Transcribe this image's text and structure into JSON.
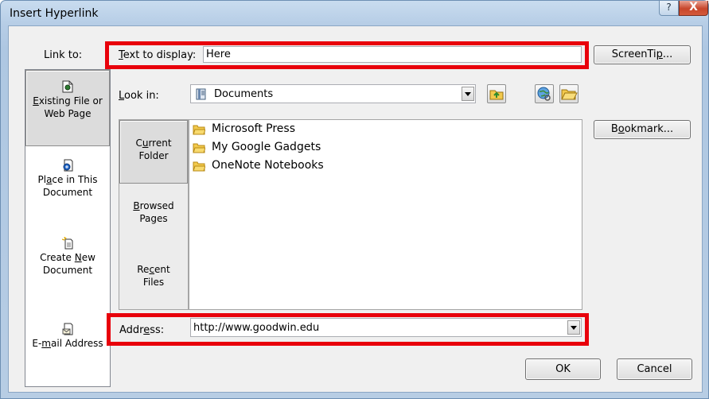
{
  "window": {
    "title": "Insert Hyperlink",
    "help_glyph": "?",
    "close_glyph": "X"
  },
  "link_to": {
    "label": "Link to:",
    "items": [
      {
        "pre": "",
        "ul": "E",
        "post": "xisting File or Web Page",
        "icon": "existing-file-icon"
      },
      {
        "pre": "Pl",
        "ul": "a",
        "post": "ce in This Document",
        "icon": "place-in-document-icon"
      },
      {
        "pre": "Create ",
        "ul": "N",
        "post": "ew Document",
        "icon": "new-document-icon"
      },
      {
        "pre": "E-",
        "ul": "m",
        "post": "ail Address",
        "icon": "email-icon"
      }
    ]
  },
  "text_to_display": {
    "label_ul": "T",
    "label_rest": "ext to display:",
    "value": "Here"
  },
  "screentip": {
    "pre": "ScreenTi",
    "ul": "p",
    "post": "..."
  },
  "look_in": {
    "label_ul": "L",
    "label_rest": "ook in:",
    "value": "Documents",
    "icon": "documents-folder-icon"
  },
  "toolbar": {
    "up_icon": "up-one-folder-icon",
    "browse_web_icon": "browse-web-icon",
    "browse_file_icon": "browse-file-icon"
  },
  "places": [
    {
      "line1_pre": "C",
      "line1_ul": "u",
      "line1_post": "rrent",
      "line2": "Folder"
    },
    {
      "line1_pre": "",
      "line1_ul": "B",
      "line1_post": "rowsed",
      "line2": "Pages"
    },
    {
      "line1_pre": "Re",
      "line1_ul": "c",
      "line1_post": "ent",
      "line2": "Files"
    }
  ],
  "files": [
    {
      "name": "Microsoft Press",
      "icon": "folder-icon"
    },
    {
      "name": "My Google Gadgets",
      "icon": "folder-icon"
    },
    {
      "name": "OneNote Notebooks",
      "icon": "folder-icon"
    }
  ],
  "bookmark": {
    "pre": "B",
    "ul": "o",
    "post": "okmark..."
  },
  "address": {
    "label_pre": "Addr",
    "label_ul": "e",
    "label_post": "ss:",
    "value": "http://www.goodwin.edu"
  },
  "buttons": {
    "ok": "OK",
    "cancel": "Cancel"
  },
  "colors": {
    "highlight": "#e8000b",
    "title_gradient": "#b6cde6",
    "close_button": "#c7462b"
  }
}
